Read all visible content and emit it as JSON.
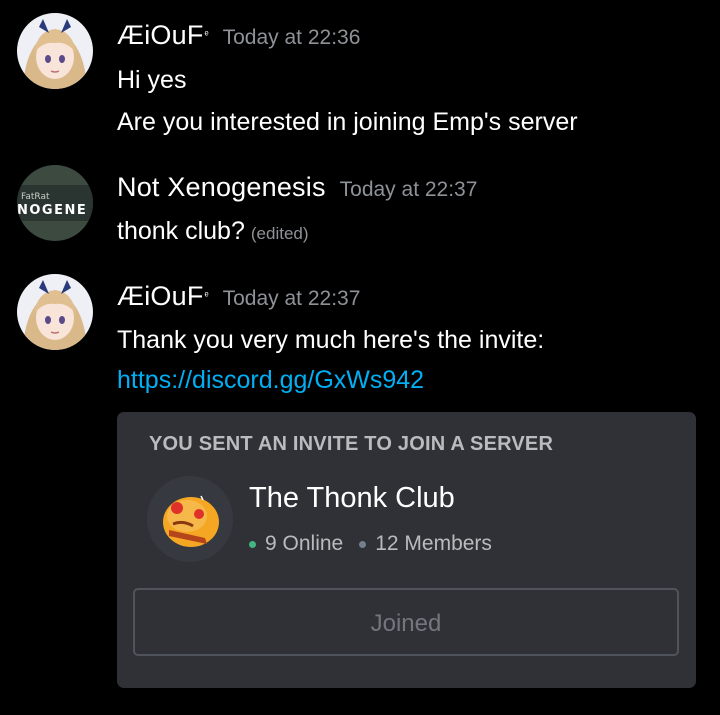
{
  "messages": [
    {
      "username": "ÆiOuF",
      "username_badge": "ᵉ",
      "timestamp": "Today at 22:36",
      "avatar_icon": "anime-girl-avatar",
      "lines": [
        "Hi yes",
        "Are you interested in joining Emp's server"
      ]
    },
    {
      "username": "Not Xenogenesis",
      "timestamp": "Today at 22:37",
      "avatar_icon": "thefatrat-xenogenesis-avatar",
      "avatar_text_top": "FatRat",
      "avatar_text_bottom": "NOGENE",
      "lines": [
        "thonk club?"
      ],
      "edited_label": "(edited)"
    },
    {
      "username": "ÆiOuF",
      "username_badge": "ᵉ",
      "timestamp": "Today at 22:37",
      "avatar_icon": "anime-girl-avatar",
      "lines": [
        "Thank you very much here's the invite:"
      ],
      "link": "https://discord.gg/GxWs942"
    }
  ],
  "invite": {
    "title": "YOU SENT AN INVITE TO JOIN A SERVER",
    "server_name": "The Thonk Club",
    "server_icon": "thonk-emoji-icon",
    "online": "9 Online",
    "members": "12 Members",
    "button_label": "Joined"
  },
  "colors": {
    "background": "#000000",
    "timestamp": "#8e9297",
    "link": "#00aff4",
    "embed_bg": "#2f3136",
    "online_dot": "#43b581",
    "members_dot": "#747f8d"
  }
}
